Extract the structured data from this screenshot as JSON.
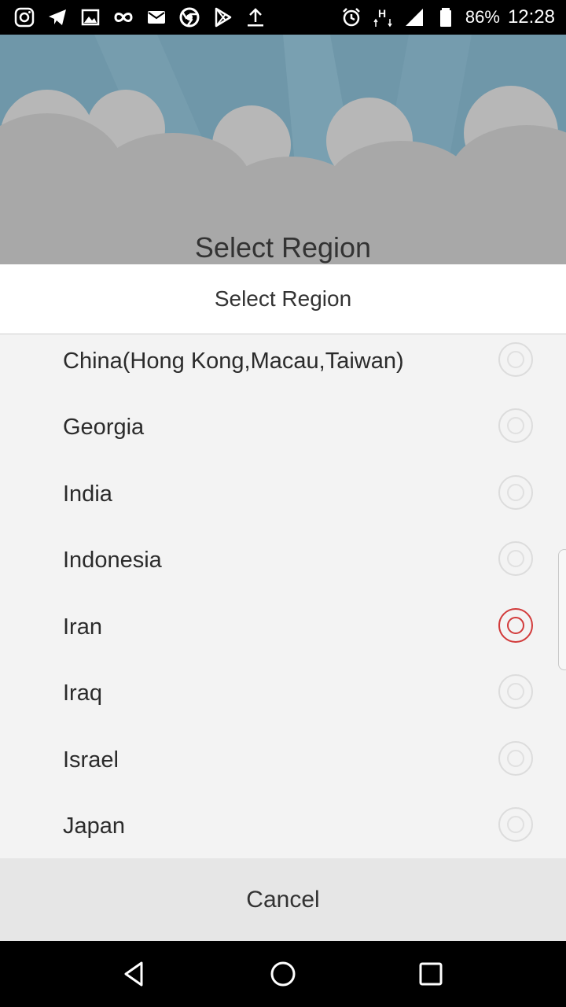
{
  "status_bar": {
    "battery_percent": "86%",
    "time": "12:28",
    "left_icons": [
      "instagram-icon",
      "telegram-icon",
      "gallery-icon",
      "infinity-icon",
      "mail-icon",
      "chrome-icon",
      "play-store-icon",
      "upload-icon"
    ],
    "right_icons": [
      "alarm-icon",
      "h-signal-icon",
      "cell-signal-icon",
      "battery-icon"
    ]
  },
  "background": {
    "title": "Select Region",
    "sky_color": "#6f97a9",
    "cloud_color": "#a8a8a8"
  },
  "dialog": {
    "title": "Select Region",
    "regions": [
      {
        "name": "China(Hong Kong,Macau,Taiwan)",
        "selected": false
      },
      {
        "name": "Georgia",
        "selected": false
      },
      {
        "name": "India",
        "selected": false
      },
      {
        "name": "Indonesia",
        "selected": false
      },
      {
        "name": "Iran",
        "selected": true
      },
      {
        "name": "Iraq",
        "selected": false
      },
      {
        "name": "Israel",
        "selected": false
      },
      {
        "name": "Japan",
        "selected": false
      }
    ],
    "cancel_label": "Cancel",
    "accent_color": "#d23a3a"
  },
  "nav_bar": {
    "buttons": [
      "back-icon",
      "home-icon",
      "recents-icon"
    ]
  }
}
